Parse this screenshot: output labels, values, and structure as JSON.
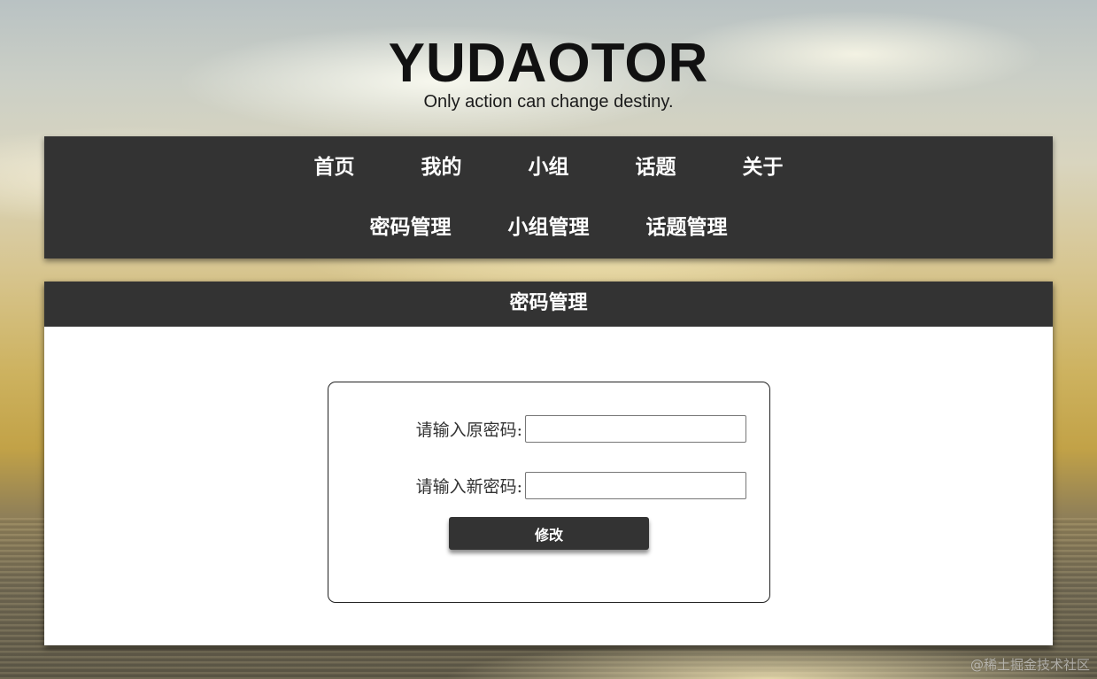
{
  "header": {
    "title": "YUDAOTOR",
    "slogan": "Only action can change destiny."
  },
  "nav": {
    "row1": [
      {
        "label": "首页"
      },
      {
        "label": "我的"
      },
      {
        "label": "小组"
      },
      {
        "label": "话题"
      },
      {
        "label": "关于"
      }
    ],
    "row2": [
      {
        "label": "密码管理"
      },
      {
        "label": "小组管理"
      },
      {
        "label": "话题管理"
      }
    ]
  },
  "panel": {
    "title": "密码管理",
    "form": {
      "old_password_label": "请输入原密码:",
      "old_password_value": "",
      "new_password_label": "请输入新密码:",
      "new_password_value": "",
      "submit_label": "修改"
    }
  },
  "watermark": "@稀土掘金技术社区",
  "colors": {
    "dark_bar": "#333333",
    "panel_bg": "#ffffff",
    "nav_text": "#ffffff"
  }
}
